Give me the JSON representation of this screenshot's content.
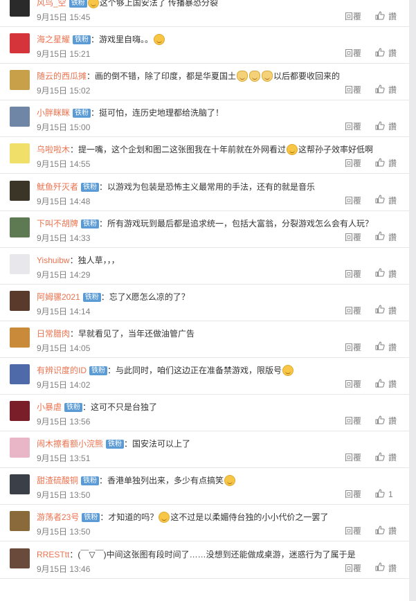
{
  "reply_label": "回覆",
  "like_default": "讚",
  "badge_label": "铁粉",
  "comments": [
    {
      "user": "风鸟_空",
      "badge": true,
      "parts": [
        {
          "t": "emoji",
          "k": "grin"
        },
        {
          "t": "text",
          "v": "这个够上国安法了 传播暴恐分裂"
        }
      ],
      "time": "9月15日 15:45",
      "likes": "讚",
      "avatar_color": "#2a2a2a"
    },
    {
      "user": "海之星耀",
      "badge": true,
      "parts": [
        {
          "t": "text",
          "v": "：游戏里自嗨。。"
        },
        {
          "t": "emoji",
          "k": "laugh"
        }
      ],
      "time": "9月15日 15:21",
      "likes": "讚",
      "avatar_color": "#d5343a"
    },
    {
      "user": "随云的西瓜摊",
      "badge": false,
      "parts": [
        {
          "t": "text",
          "v": "：画的倒不错，除了印度，都是华夏国土"
        },
        {
          "t": "emoji",
          "k": "cat"
        },
        {
          "t": "emoji",
          "k": "cat"
        },
        {
          "t": "emoji",
          "k": "cat"
        },
        {
          "t": "text",
          "v": "以后都要收回来的"
        }
      ],
      "time": "9月15日 15:02",
      "likes": "讚",
      "avatar_color": "#c9a04a"
    },
    {
      "user": "小胖眯眯",
      "badge": true,
      "parts": [
        {
          "t": "text",
          "v": "：挺可怕，连历史地理都给洗脑了！"
        }
      ],
      "time": "9月15日 15:00",
      "likes": "讚",
      "avatar_color": "#6f86a6"
    },
    {
      "user": "乌啦啦木",
      "badge": false,
      "parts": [
        {
          "t": "text",
          "v": "：提一嘴，这个企划和图二这张图我在十年前就在外网看过"
        },
        {
          "t": "emoji",
          "k": "grin"
        },
        {
          "t": "text",
          "v": "这帮孙子效率好低啊"
        }
      ],
      "time": "9月15日 14:55",
      "likes": "讚",
      "avatar_color": "#f0e06a"
    },
    {
      "user": "鱿鱼歼灭者",
      "badge": true,
      "parts": [
        {
          "t": "text",
          "v": "：以游戏为包装是恐怖主义最常用的手法，还有的就是音乐"
        }
      ],
      "time": "9月15日 14:48",
      "likes": "讚",
      "avatar_color": "#3a3526"
    },
    {
      "user": "下叫不胡牌",
      "badge": true,
      "parts": [
        {
          "t": "text",
          "v": "：所有游戏玩到最后都是追求统一，包括大富翁，分裂游戏怎么会有人玩？"
        }
      ],
      "time": "9月15日 14:33",
      "likes": "讚",
      "avatar_color": "#5e7a52"
    },
    {
      "user": "Yishuibw",
      "badge": false,
      "parts": [
        {
          "t": "text",
          "v": "：独人草，，，"
        }
      ],
      "time": "9月15日 14:29",
      "likes": "讚",
      "avatar_color": "#e8e8ec"
    },
    {
      "user": "阿姆骡2021",
      "badge": true,
      "parts": [
        {
          "t": "text",
          "v": "：忘了X愿怎么凉的了？"
        }
      ],
      "time": "9月15日 14:14",
      "likes": "讚",
      "avatar_color": "#5a3a2a"
    },
    {
      "user": "日常腊肉",
      "badge": false,
      "parts": [
        {
          "t": "text",
          "v": "：早就看见了，当年还做油管广告"
        }
      ],
      "time": "9月15日 14:05",
      "likes": "讚",
      "avatar_color": "#c98a3a"
    },
    {
      "user": "有辨识度的ID",
      "badge": true,
      "parts": [
        {
          "t": "text",
          "v": "：与此同时，咱们这边正在准备禁游戏，限版号"
        },
        {
          "t": "emoji",
          "k": "laugh"
        }
      ],
      "time": "9月15日 14:02",
      "likes": "讚",
      "avatar_color": "#4f6aa8"
    },
    {
      "user": "小暴虐",
      "badge": true,
      "parts": [
        {
          "t": "text",
          "v": "：这可不只是台独了"
        }
      ],
      "time": "9月15日 13:56",
      "likes": "讚",
      "avatar_color": "#7a1e2a"
    },
    {
      "user": "闹木擦看额小浣熊",
      "badge": true,
      "parts": [
        {
          "t": "text",
          "v": "：国安法可以上了"
        }
      ],
      "time": "9月15日 13:51",
      "likes": "讚",
      "avatar_color": "#e9b6c8"
    },
    {
      "user": "甜渣硫酸铜",
      "badge": true,
      "parts": [
        {
          "t": "text",
          "v": "：香港单独列出来，多少有点搞笑"
        },
        {
          "t": "emoji",
          "k": "laugh"
        }
      ],
      "time": "9月15日 13:50",
      "likes": "1",
      "avatar_color": "#3b4048"
    },
    {
      "user": "游荡者23号",
      "badge": true,
      "parts": [
        {
          "t": "text",
          "v": "：才知道的吗？"
        },
        {
          "t": "emoji",
          "k": "grin"
        },
        {
          "t": "text",
          "v": "这不过是以柔媚侍台独的小小代价之一罢了"
        }
      ],
      "time": "9月15日 13:50",
      "likes": "讚",
      "avatar_color": "#8a6a3a"
    },
    {
      "user": "RRESTtt",
      "badge": false,
      "parts": [
        {
          "t": "text",
          "v": "：(￣▽￣)中间这张图有段时间了……没想到还能做成桌游，迷惑行为了属于是"
        }
      ],
      "time": "9月15日 13:46",
      "likes": "讚",
      "avatar_color": "#6a4a3a"
    }
  ]
}
